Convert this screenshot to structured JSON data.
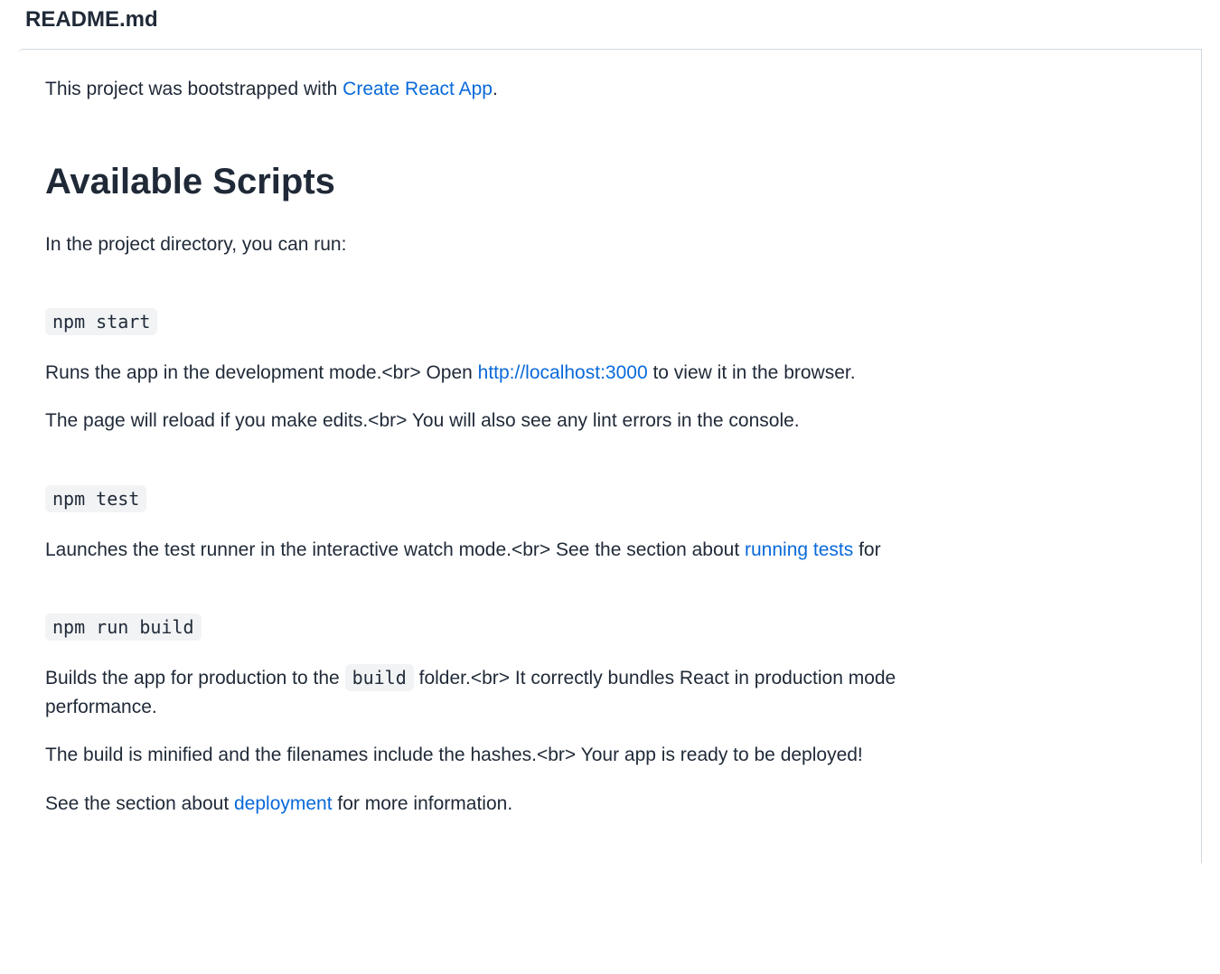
{
  "file": {
    "name": "README.md"
  },
  "intro": {
    "prefix": "This project was bootstrapped with ",
    "link_text": "Create React App",
    "suffix": "."
  },
  "heading_scripts": "Available Scripts",
  "scripts_intro": "In the project directory, you can run:",
  "sections": {
    "start": {
      "cmd": "npm start",
      "p1a": "Runs the app in the development mode.<br> Open ",
      "p1_link": "http://localhost:3000",
      "p1b": " to view it in the browser.",
      "p2": "The page will reload if you make edits.<br> You will also see any lint errors in the console."
    },
    "test": {
      "cmd": "npm test",
      "p1a": "Launches the test runner in the interactive watch mode.<br> See the section about ",
      "p1_link": "running tests",
      "p1b": " for"
    },
    "build": {
      "cmd": "npm run build",
      "p1a": "Builds the app for production to the ",
      "code1": "build",
      "p1b": " folder.<br> It correctly bundles React in production mode",
      "p1c": "performance.",
      "p2": "The build is minified and the filenames include the hashes.<br> Your app is ready to be deployed!",
      "p3a": "See the section about ",
      "p3_link": "deployment",
      "p3b": " for more information."
    }
  }
}
